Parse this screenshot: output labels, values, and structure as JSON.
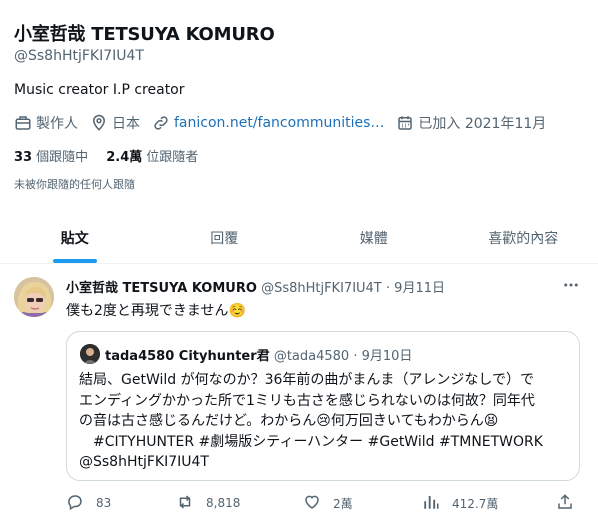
{
  "profile": {
    "display_name": "小室哲哉 TETSUYA KOMURO",
    "handle": "@Ss8hHtjFKI7IU4T",
    "bio": "Music creator I.P creator",
    "category": "製作人",
    "location": "日本",
    "website": "fanicon.net/fancommunities…",
    "joined": "已加入 2021年11月",
    "following_count": "33",
    "following_label": "個跟隨中",
    "followers_count": "2.4萬",
    "followers_label": "位跟隨者",
    "not_followed_text": "未被你跟隨的任何人跟隨"
  },
  "tabs": [
    {
      "label": "貼文",
      "active": true
    },
    {
      "label": "回覆",
      "active": false
    },
    {
      "label": "媒體",
      "active": false
    },
    {
      "label": "喜歡的內容",
      "active": false
    }
  ],
  "tweet": {
    "author_name": "小室哲哉 TETSUYA KOMURO",
    "author_handle": "@Ss8hHtjFKI7IU4T",
    "date": "· 9月11日",
    "text": "僕も2度と再現できません☺️",
    "quote": {
      "author_name": "tada4580 Cityhunter君",
      "author_handle": "@tada4580",
      "date": "· 9月10日",
      "line1": "結局、GetWild が何なのか？36年前の曲がまんま（アレンジなしで）で",
      "line2": "エンディングかかった所で1ミリも古さを感じられないのは何故？同年代",
      "line3": "の音は古さ感じるんだけど。わからん😢何万回きいてもわからん😫",
      "line4": "　#CITYHUNTER #劇場版シティーハンター #GetWild #TMNETWORK",
      "line5": "@Ss8hHtjFKI7IU4T"
    },
    "stats": {
      "replies": "83",
      "retweets": "8,818",
      "likes": "2萬",
      "views": "412.7萬"
    }
  },
  "colors": {
    "accent": "#1d9bf0",
    "link": "#1d70b8",
    "secondary_text": "#536471",
    "border": "#cfd9de"
  }
}
